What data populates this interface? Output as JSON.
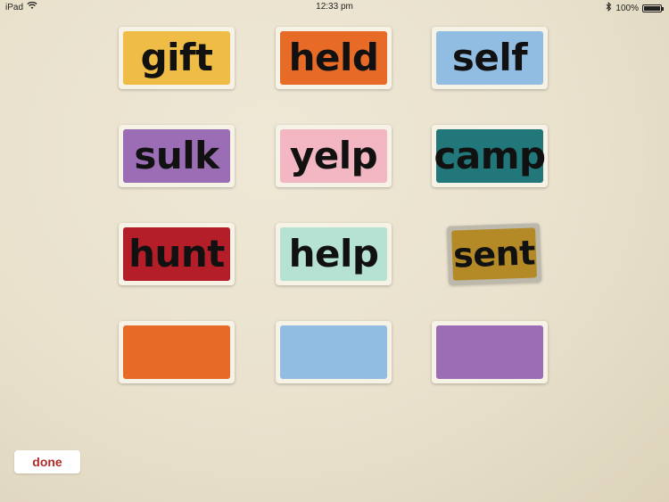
{
  "status_bar": {
    "device": "iPad",
    "time": "12:33 pm",
    "battery": "100%",
    "battery_level": 1.0
  },
  "cards": [
    {
      "id": "gift",
      "word": "gift",
      "color": "#efbd45"
    },
    {
      "id": "held",
      "word": "held",
      "color": "#e86a27"
    },
    {
      "id": "self",
      "word": "self",
      "color": "#92bde3"
    },
    {
      "id": "sulk",
      "word": "sulk",
      "color": "#9a6db4"
    },
    {
      "id": "yelp",
      "word": "yelp",
      "color": "#f2b7c2"
    },
    {
      "id": "camp",
      "word": "camp",
      "color": "#217779"
    },
    {
      "id": "hunt",
      "word": "hunt",
      "color": "#b41e28"
    },
    {
      "id": "help",
      "word": "help",
      "color": "#b5e2d2"
    },
    {
      "id": "sent",
      "word": "sent",
      "color": "#b38a26"
    },
    {
      "id": "blank-orange",
      "word": "",
      "color": "#e86a27"
    },
    {
      "id": "blank-blue",
      "word": "",
      "color": "#92bde3"
    },
    {
      "id": "blank-purple",
      "word": "",
      "color": "#9a6db4"
    }
  ],
  "done_button": {
    "label": "done",
    "color": "#b22a2a"
  },
  "icons": {
    "wifi": "wifi-icon",
    "bluetooth": "bluetooth-icon",
    "battery": "battery-icon"
  }
}
